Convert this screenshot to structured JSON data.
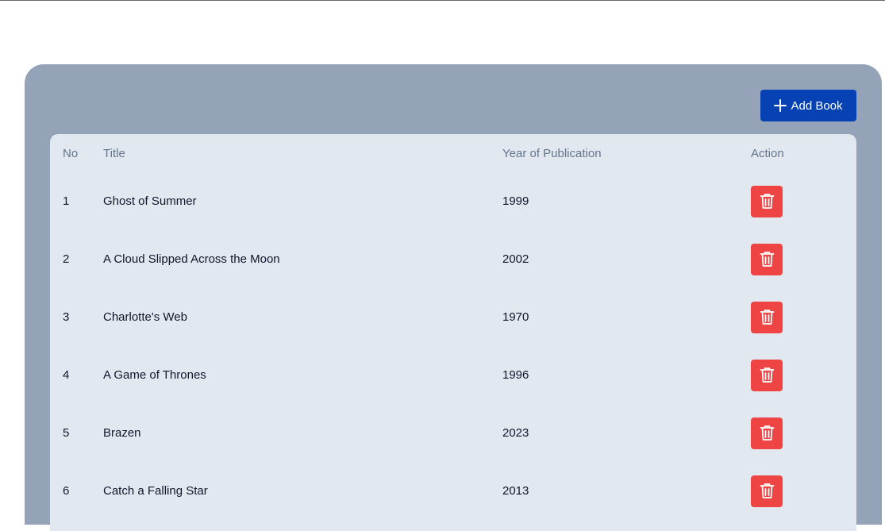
{
  "toolbar": {
    "add_label": "Add Book",
    "add_icon": "plus-icon"
  },
  "table": {
    "headers": {
      "no": "No",
      "title": "Title",
      "year": "Year of Publication",
      "action": "Action"
    },
    "rows": [
      {
        "no": "1",
        "title": "Ghost of Summer",
        "year": "1999"
      },
      {
        "no": "2",
        "title": "A Cloud Slipped Across the Moon",
        "year": "2002"
      },
      {
        "no": "3",
        "title": "Charlotte's Web",
        "year": "1970"
      },
      {
        "no": "4",
        "title": "A Game of Thrones",
        "year": "1996"
      },
      {
        "no": "5",
        "title": "Brazen",
        "year": "2023"
      },
      {
        "no": "6",
        "title": "Catch a Falling Star",
        "year": "2013"
      }
    ],
    "row_action_icon": "trash-icon"
  },
  "colors": {
    "panel": "#94a3b8",
    "table_bg": "#e2e8f0",
    "primary_button": "#0742b5",
    "delete_button": "#ef4444"
  }
}
